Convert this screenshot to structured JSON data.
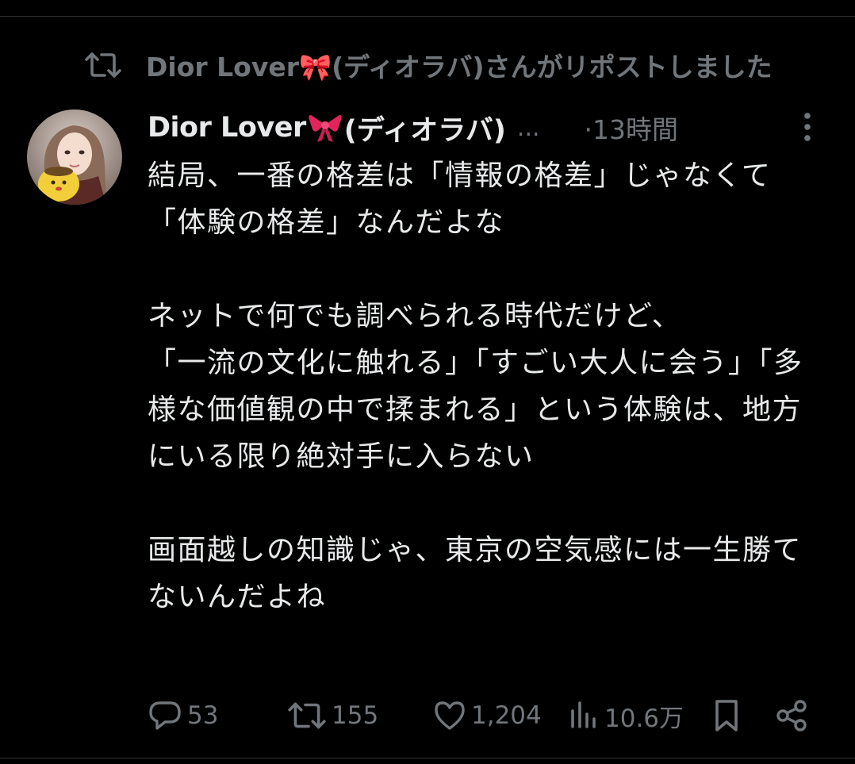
{
  "repost_banner": {
    "text": "Dior Lover🎀(ディオラバ)さんがリポストしました",
    "icon": "repost-icon"
  },
  "tweet": {
    "author": {
      "display_name": "Dior Lover",
      "name_emoji": "🎀",
      "name_suffix": "(ディオラバ)",
      "truncation": "...",
      "avatar": "avatar"
    },
    "time": "·13時間",
    "more_icon": "more-vertical-icon",
    "text": "結局、一番の格差は「情報の格差」じゃなくて「体験の格差」なんだよな\n\nネットで何でも調べられる時代だけど、\n「一流の文化に触れる」「すごい大人に会う」「多様な価値観の中で揉まれる」という体験は、地方にいる限り絶対手に入らない\n\n画面越しの知識じゃ、東京の空気感には一生勝てないんだよね"
  },
  "actions": {
    "reply": {
      "icon": "reply-icon",
      "count": "53"
    },
    "repost": {
      "icon": "repost-icon",
      "count": "155"
    },
    "like": {
      "icon": "heart-icon",
      "count": "1,204"
    },
    "views": {
      "icon": "views-icon",
      "count": "10.6万"
    },
    "bookmark": {
      "icon": "bookmark-icon"
    },
    "share": {
      "icon": "share-icon"
    }
  },
  "colors": {
    "background": "#000000",
    "primary_text": "#e7e9ea",
    "secondary_text": "#71767b",
    "divider": "#2f3336",
    "ribbon": "#e0245e"
  }
}
